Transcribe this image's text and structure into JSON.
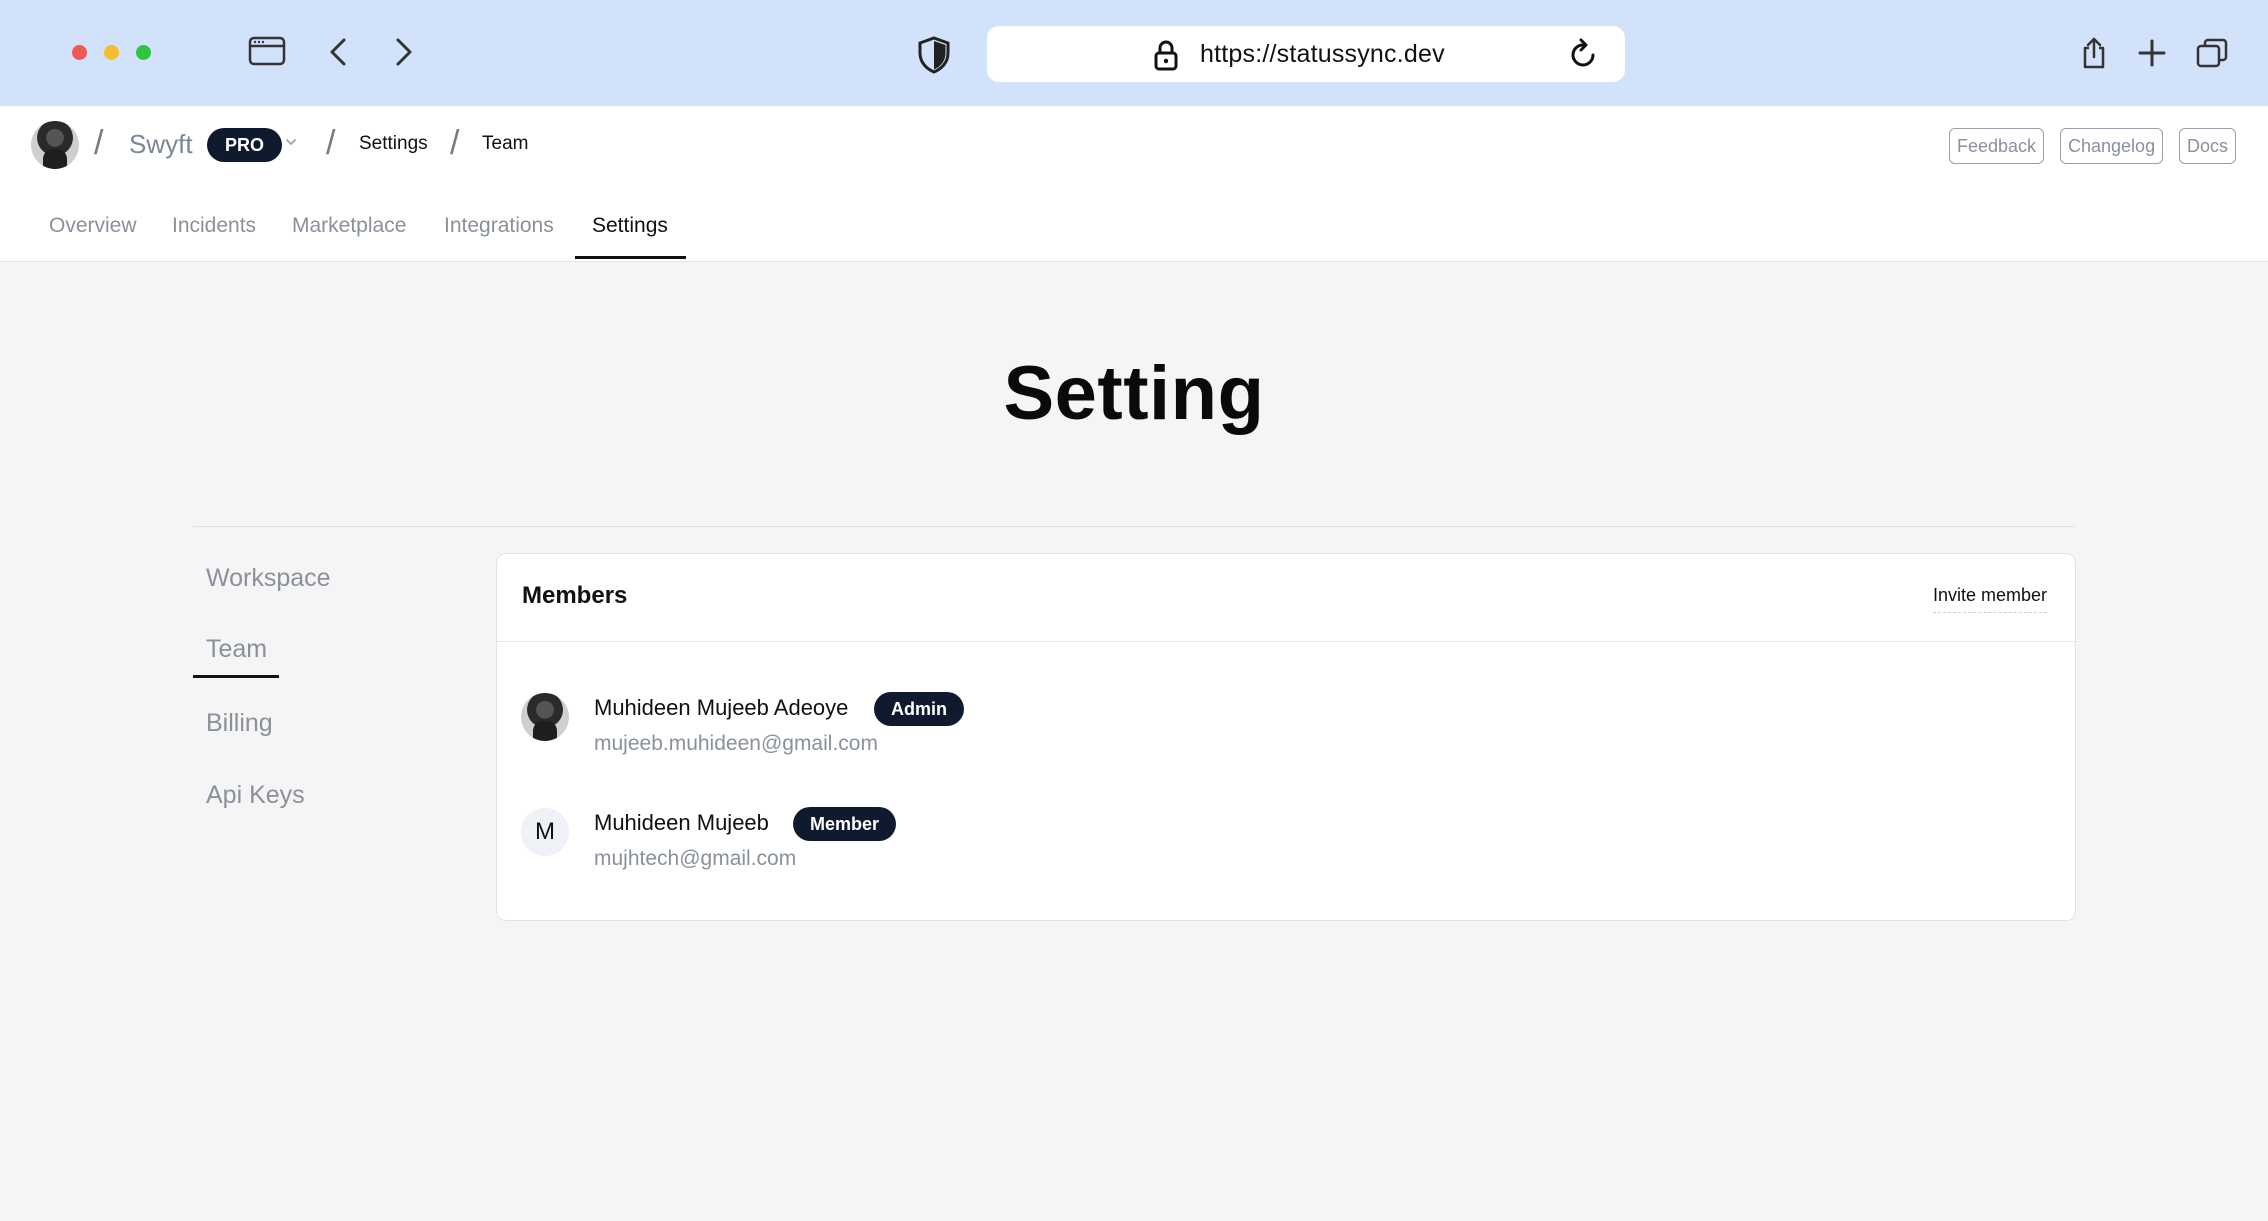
{
  "browser": {
    "url": "https://statussync.dev",
    "icons": [
      "sidebar-icon",
      "back-icon",
      "forward-icon",
      "shield-icon",
      "lock-icon",
      "reload-icon",
      "share-icon",
      "new-tab-icon",
      "tabs-icon"
    ]
  },
  "header": {
    "workspace": "Swyft",
    "plan_badge": "PRO",
    "breadcrumbs": [
      "Settings",
      "Team"
    ],
    "actions": [
      "Feedback",
      "Changelog",
      "Docs"
    ]
  },
  "tabs": [
    {
      "label": "Overview"
    },
    {
      "label": "Incidents"
    },
    {
      "label": "Marketplace"
    },
    {
      "label": "Integrations"
    },
    {
      "label": "Settings",
      "active": true
    }
  ],
  "page": {
    "title": "Setting"
  },
  "settings_nav": [
    {
      "label": "Workspace"
    },
    {
      "label": "Team",
      "active": true
    },
    {
      "label": "Billing"
    },
    {
      "label": "Api Keys"
    }
  ],
  "members_card": {
    "title": "Members",
    "invite_label": "Invite member",
    "members": [
      {
        "name": "Muhideen Mujeeb Adeoye",
        "role": "Admin",
        "email": "mujeeb.muhideen@gmail.com",
        "avatar": "photo"
      },
      {
        "name": "Muhideen Mujeeb",
        "role": "Member",
        "email": "mujhtech@gmail.com",
        "avatar": "M"
      }
    ]
  },
  "colors": {
    "chrome_bg": "#d3e2fb",
    "badge_bg": "#0f1a2e",
    "muted_text": "#8a919c",
    "page_bg": "#f5f5f5"
  }
}
